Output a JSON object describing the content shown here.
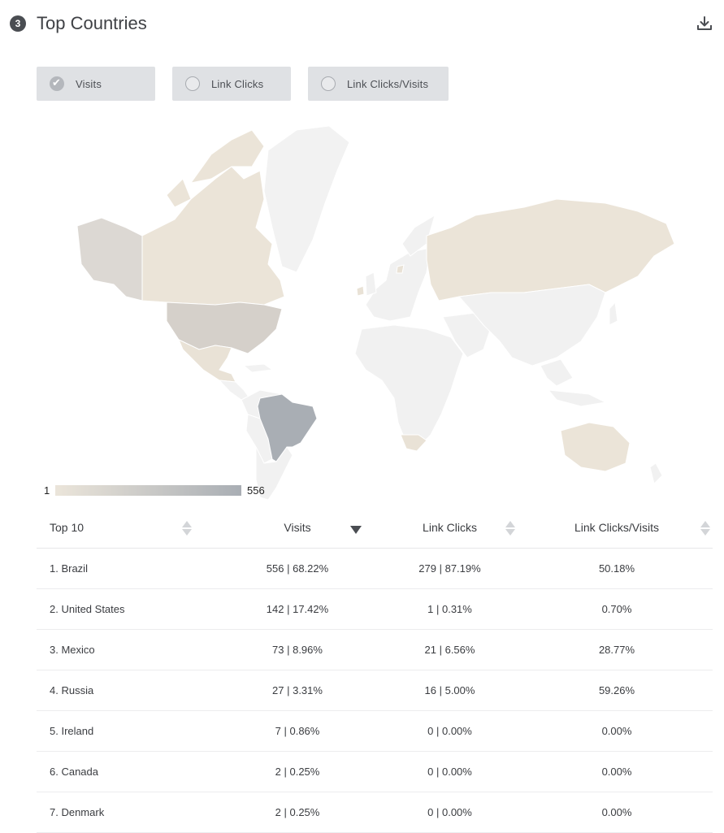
{
  "header": {
    "step_number": "3",
    "title": "Top Countries",
    "download_icon": "download-icon"
  },
  "toggles": [
    {
      "label": "Visits",
      "checked": true
    },
    {
      "label": "Link Clicks",
      "checked": false
    },
    {
      "label": "Link Clicks/Visits",
      "checked": false
    }
  ],
  "map": {
    "highlight_colors": {
      "max": "#a9aeb4",
      "mid": "#cfc9c2",
      "low": "#e9e2d6",
      "none": "#f2f2f2",
      "border": "#ffffff"
    },
    "legend": {
      "min": "1",
      "max": "556"
    }
  },
  "table": {
    "headers": {
      "col1": "Top 10",
      "col2": "Visits",
      "col3": "Link Clicks",
      "col4": "Link Clicks/Visits"
    },
    "sorted_column": "Visits",
    "sort_direction": "descending",
    "rows": [
      {
        "country": "1. Brazil",
        "visits": "556 | 68.22%",
        "clicks": "279 | 87.19%",
        "ratio": "50.18%"
      },
      {
        "country": "2. United States",
        "visits": "142 | 17.42%",
        "clicks": "1 | 0.31%",
        "ratio": "0.70%"
      },
      {
        "country": "3. Mexico",
        "visits": "73 | 8.96%",
        "clicks": "21 | 6.56%",
        "ratio": "28.77%"
      },
      {
        "country": "4. Russia",
        "visits": "27 | 3.31%",
        "clicks": "16 | 5.00%",
        "ratio": "59.26%"
      },
      {
        "country": "5. Ireland",
        "visits": "7 | 0.86%",
        "clicks": "0 | 0.00%",
        "ratio": "0.00%"
      },
      {
        "country": "6. Canada",
        "visits": "2 | 0.25%",
        "clicks": "0 | 0.00%",
        "ratio": "0.00%"
      },
      {
        "country": "7. Denmark",
        "visits": "2 | 0.25%",
        "clicks": "0 | 0.00%",
        "ratio": "0.00%"
      }
    ]
  }
}
